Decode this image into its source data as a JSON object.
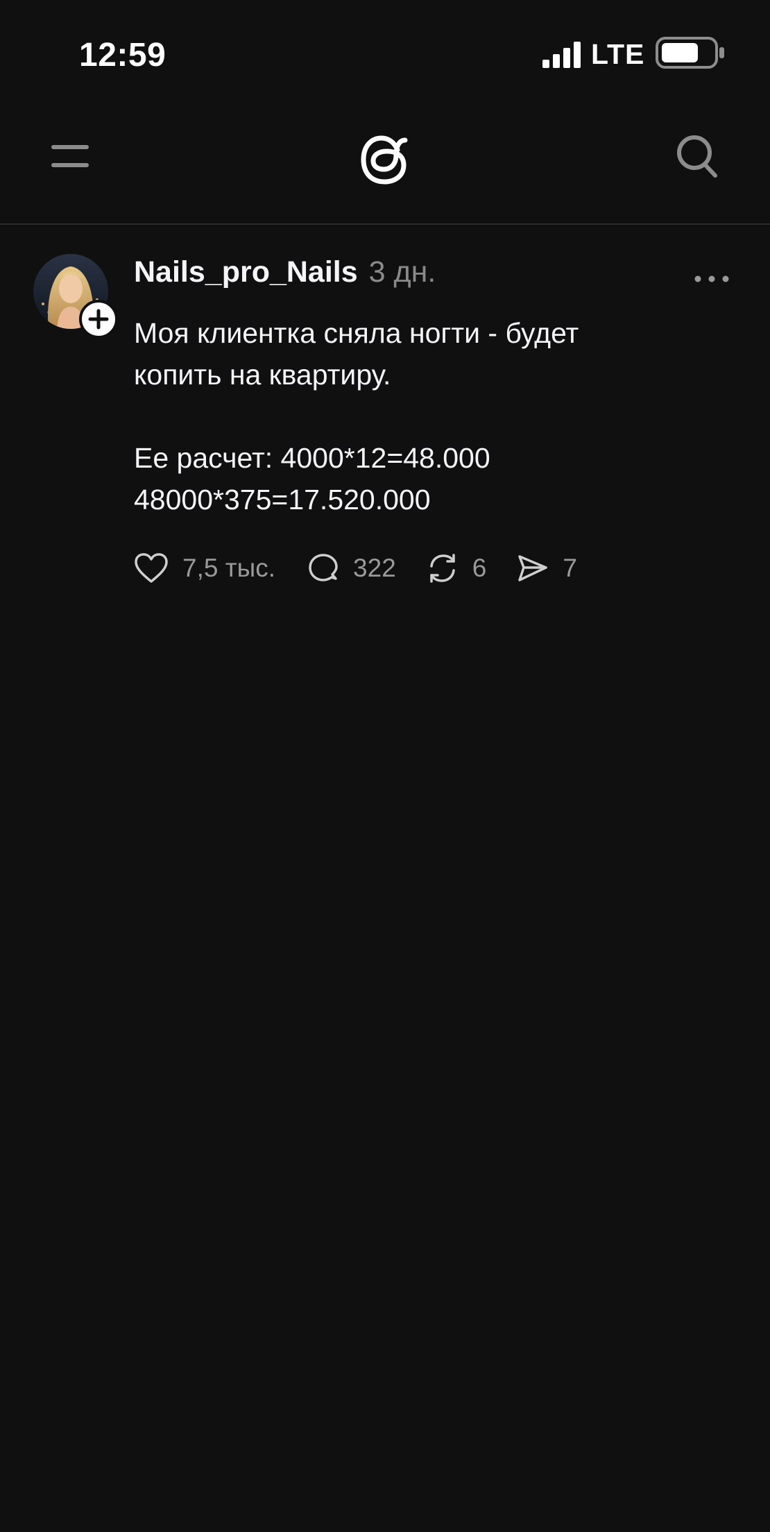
{
  "status_bar": {
    "time": "12:59",
    "network": "LTE",
    "icons": [
      "signal-icon",
      "battery-icon"
    ]
  },
  "top_nav": {
    "icons": [
      "menu-icon",
      "threads-logo",
      "search-icon"
    ]
  },
  "post": {
    "author": "Nails_pro_Nails",
    "time_ago": "3 дн.",
    "body": {
      "line1": "Моя клиентка сняла ногти - будет",
      "line2": "копить на квартиру.",
      "line3": "Ее расчет: 4000*12=48.000",
      "line4": "48000*375=17.520.000"
    },
    "actions": {
      "likes": "7,5 тыс.",
      "replies": "322",
      "reposts": "6",
      "shares": "7"
    }
  },
  "colors": {
    "background": "#101010",
    "text_primary": "#f3f5f7",
    "text_secondary": "#8a8a8a",
    "divider": "#2d2d2d"
  }
}
